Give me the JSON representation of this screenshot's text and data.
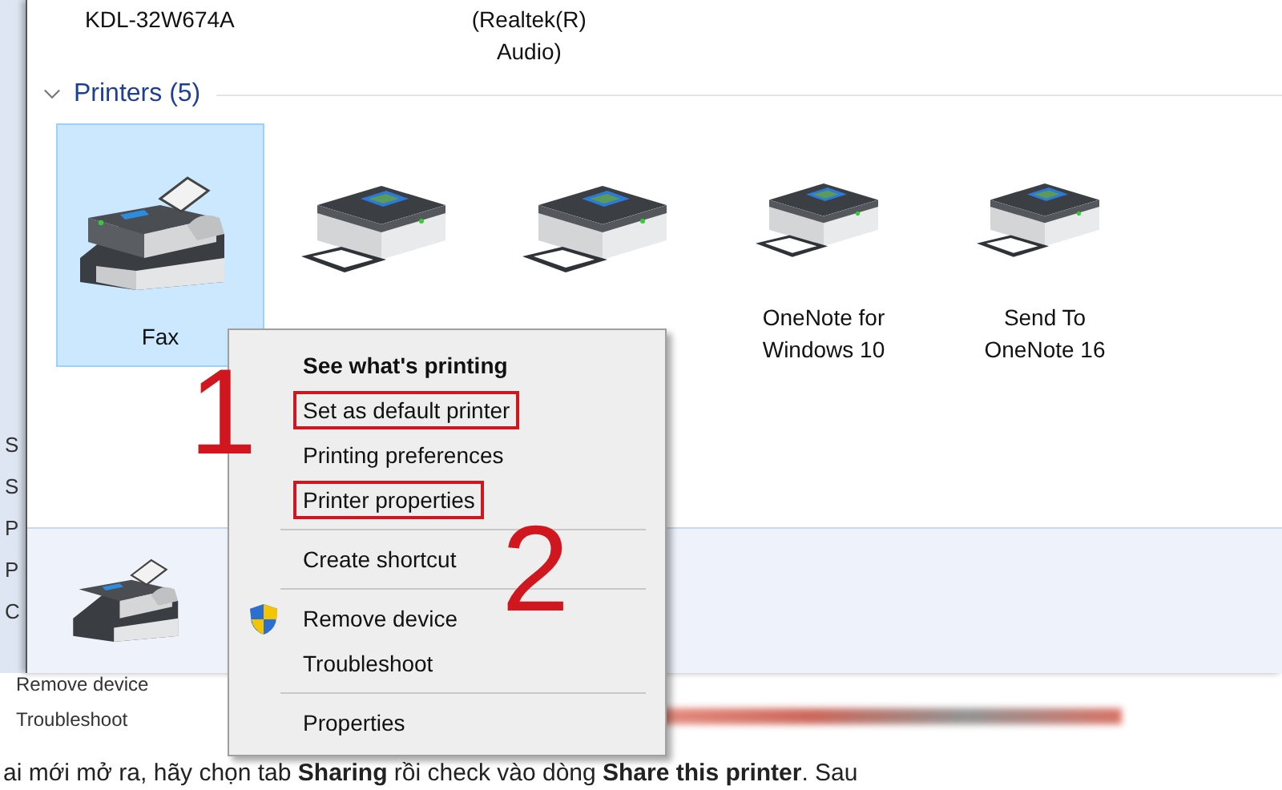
{
  "background_window": {
    "letters": [
      "S",
      "S",
      "P",
      "P",
      "C"
    ],
    "items": [
      "Remove device",
      "Troubleshoot"
    ]
  },
  "window": {
    "top_labels": [
      {
        "lines": [
          "KDL-32W674A"
        ]
      },
      {
        "lines": [
          "(Realtek(R)",
          "Audio)"
        ]
      }
    ],
    "group": {
      "title": "Printers (5)",
      "expanded": true
    },
    "devices": [
      {
        "kind": "fax",
        "label": [
          "Fax"
        ],
        "selected": true
      },
      {
        "kind": "printer",
        "selected": false
      },
      {
        "kind": "printer",
        "selected": false
      },
      {
        "kind": "printer",
        "label": [
          "OneNote for",
          "Windows 10"
        ],
        "selected": false
      },
      {
        "kind": "printer",
        "label": [
          "Send To",
          "OneNote 16"
        ],
        "selected": false
      }
    ],
    "details": {
      "kind": "fax"
    }
  },
  "context_menu": {
    "items": [
      {
        "kind": "item",
        "label": "See what's printing",
        "default": true,
        "highlighted": false
      },
      {
        "kind": "item",
        "label": "Set as default printer",
        "default": false,
        "highlighted": true
      },
      {
        "kind": "item",
        "label": "Printing preferences",
        "default": false,
        "highlighted": false
      },
      {
        "kind": "item",
        "label": "Printer properties",
        "default": false,
        "highlighted": true
      },
      {
        "kind": "separator"
      },
      {
        "kind": "item",
        "label": "Create shortcut",
        "default": false,
        "highlighted": false
      },
      {
        "kind": "separator"
      },
      {
        "kind": "shield_item",
        "label": "Remove device",
        "default": false,
        "highlighted": false
      },
      {
        "kind": "item",
        "label": "Troubleshoot",
        "default": false,
        "highlighted": false
      },
      {
        "kind": "separator"
      },
      {
        "kind": "item",
        "label": "Properties",
        "default": false,
        "highlighted": false
      }
    ]
  },
  "annotations": [
    {
      "label": "1"
    },
    {
      "label": "2"
    }
  ],
  "article_text": "ai mới mở ra, hãy chọn tab **Sharing** rồi check vào dòng **Share this printer**. Sau"
}
